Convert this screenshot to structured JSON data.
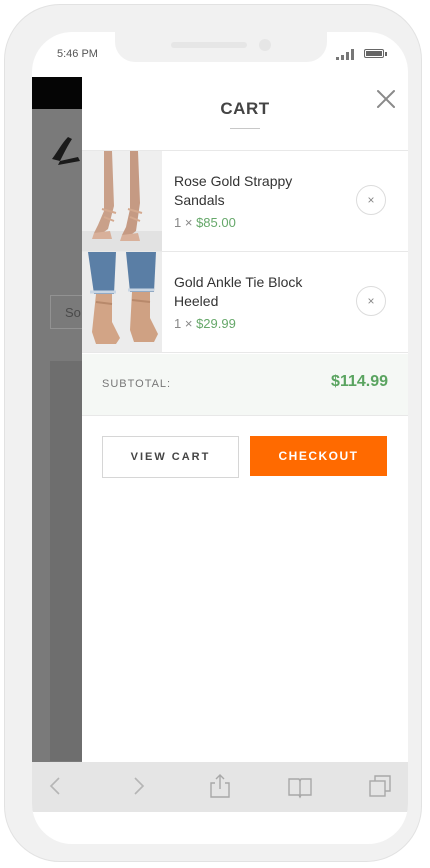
{
  "status_bar": {
    "time": "5:46 PM"
  },
  "backdrop": {
    "search_text": "So"
  },
  "cart": {
    "title": "CART",
    "close_icon": "close-icon",
    "items": [
      {
        "name": "Rose Gold Strappy Sandals",
        "quantity_prefix": "1 ×",
        "price": "$85.00",
        "remove_label": "×"
      },
      {
        "name": "Gold Ankle Tie Block Heeled",
        "quantity_prefix": "1 ×",
        "price": "$29.99",
        "remove_label": "×"
      }
    ],
    "subtotal_label": "SUBTOTAL:",
    "subtotal_value": "$114.99",
    "view_cart_label": "VIEW CART",
    "checkout_label": "CHECKOUT"
  },
  "browser_bar": {
    "icons": [
      "back-arrow-icon",
      "forward-arrow-icon",
      "share-icon",
      "bookmarks-icon",
      "tabs-icon"
    ]
  },
  "colors": {
    "accent": "#ff6a00",
    "price_green": "#66a86a",
    "subtotal_green": "#5aa460",
    "subtotal_bg": "#f5f8f5"
  }
}
